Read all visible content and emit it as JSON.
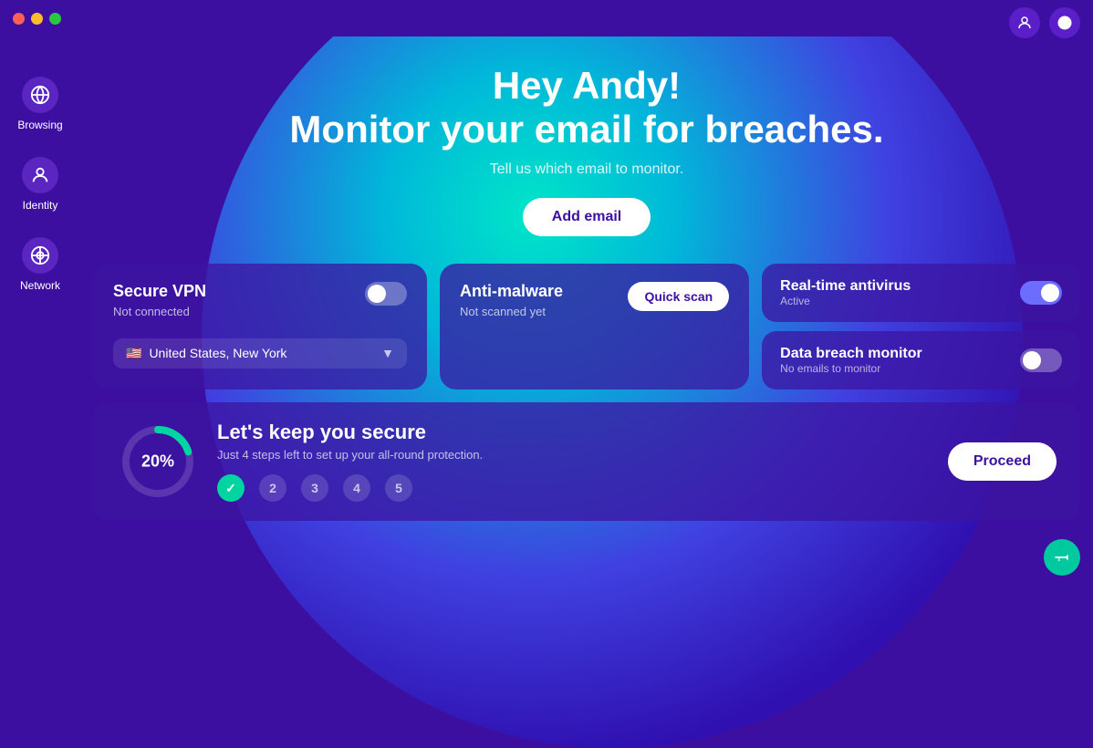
{
  "titlebar": {
    "traffic_lights": [
      "red",
      "yellow",
      "green"
    ]
  },
  "top_right": {
    "user_icon": "👤",
    "chat_icon": "💬"
  },
  "sidebar": {
    "items": [
      {
        "id": "browsing",
        "label": "Browsing",
        "icon": "🌐"
      },
      {
        "id": "identity",
        "label": "Identity",
        "icon": "👤"
      },
      {
        "id": "network",
        "label": "Network",
        "icon": "🔗"
      }
    ]
  },
  "hero": {
    "title_line1": "Hey Andy!",
    "title_line2": "Monitor your email for breaches.",
    "subtitle": "Tell us which email to monitor.",
    "add_email_label": "Add email"
  },
  "vpn_card": {
    "title": "Secure VPN",
    "status": "Not connected",
    "flag": "🇺🇸",
    "location": "United States, New York",
    "toggle_on": false
  },
  "antimalware_card": {
    "title": "Anti-malware",
    "status": "Not scanned yet",
    "quick_scan_label": "Quick scan"
  },
  "antivirus_card": {
    "title": "Real-time antivirus",
    "status": "Active",
    "toggle_on": true
  },
  "breach_card": {
    "title": "Data breach monitor",
    "status": "No emails to monitor",
    "toggle_on": false
  },
  "progress": {
    "percent": "20%",
    "title": "Let's keep you secure",
    "description": "Just 4 steps left to set up your all-round protection.",
    "steps": [
      {
        "label": "✓",
        "done": true
      },
      {
        "label": "2",
        "done": false
      },
      {
        "label": "3",
        "done": false
      },
      {
        "label": "4",
        "done": false
      },
      {
        "label": "5",
        "done": false
      }
    ],
    "proceed_label": "Proceed"
  },
  "megaphone": {
    "icon": "📢"
  }
}
